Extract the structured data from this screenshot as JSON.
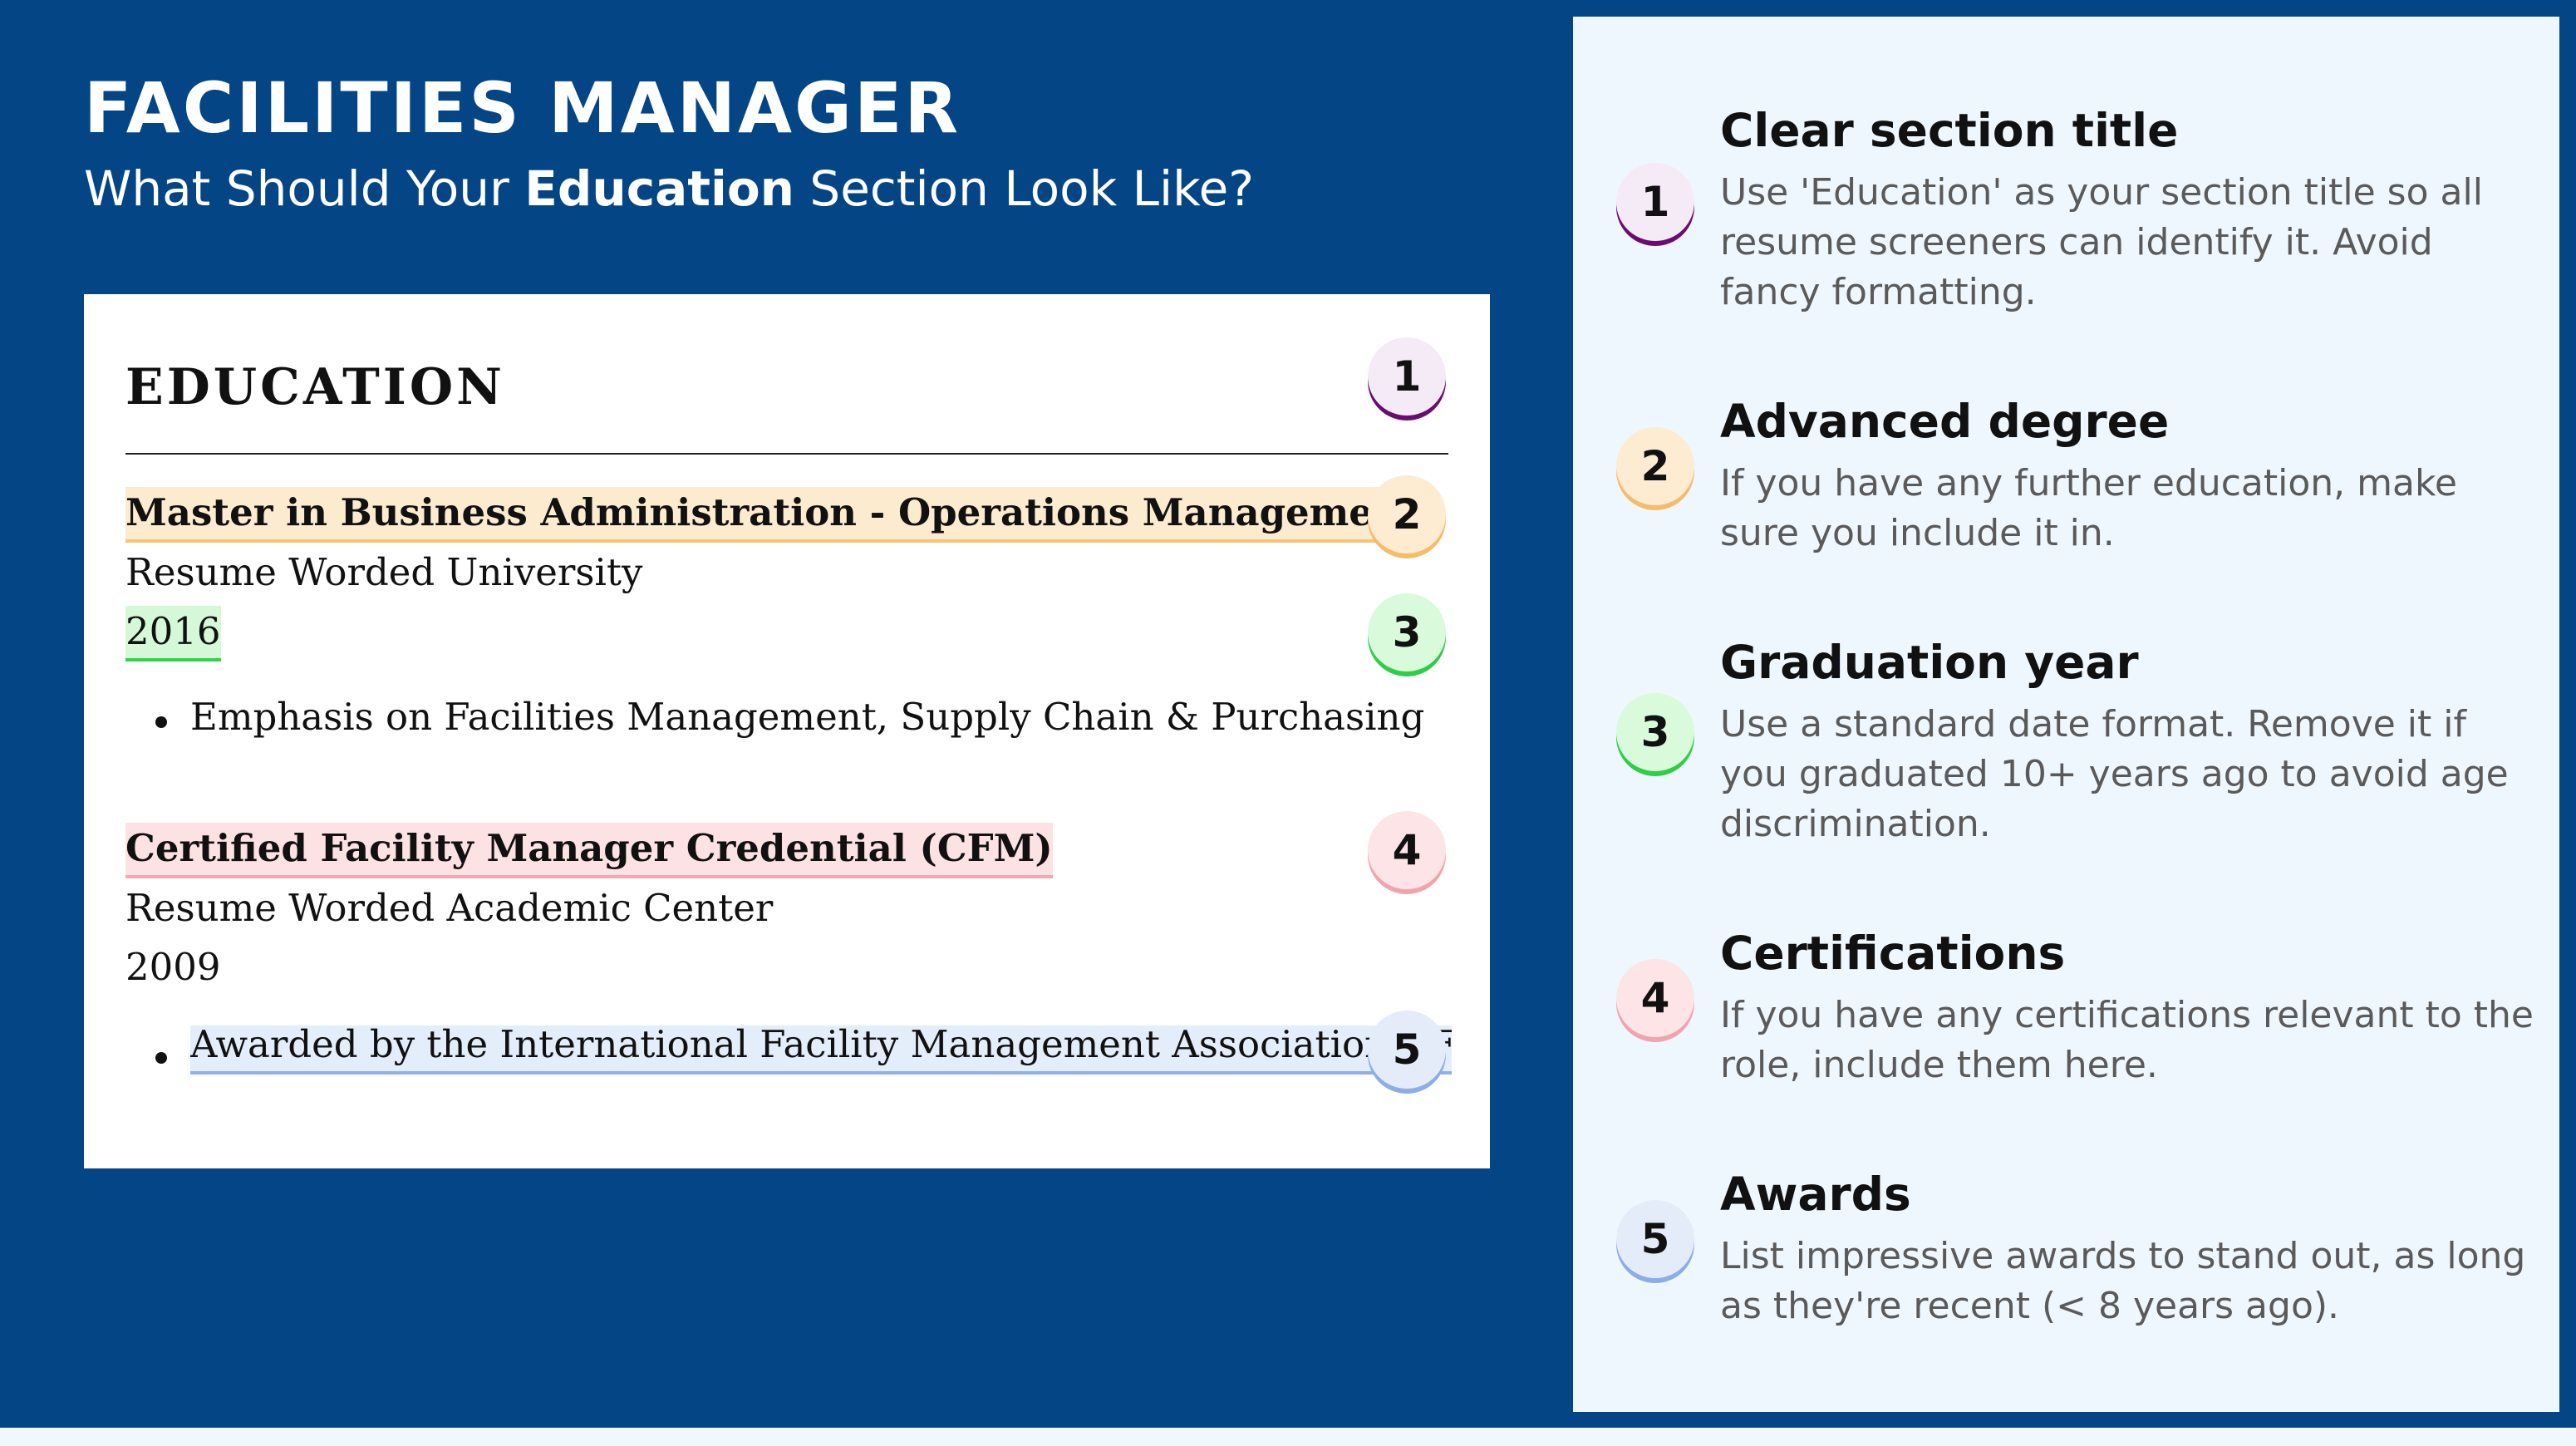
{
  "header": {
    "title": "FACILITIES MANAGER",
    "subtitle_pre": "What Should Your ",
    "subtitle_bold": "Education",
    "subtitle_post": " Section Look Like?"
  },
  "resume": {
    "heading": "EDUCATION",
    "entries": [
      {
        "degree": "Master in Business Administration - Operations Management",
        "school": "Resume Worded University",
        "year": "2016",
        "bullet": "Emphasis on Facilities Management, Supply Chain & Purchasing"
      },
      {
        "degree": "Certified Facility Manager Credential (CFM)",
        "school": "Resume Worded Academic Center",
        "year": "2009",
        "bullet": "Awarded by the International Facility Management Association (IFMA)"
      }
    ]
  },
  "tips": [
    {
      "number": "1",
      "title": "Clear section title",
      "body": "Use 'Education' as your section title so all resume screeners can identify it. Avoid fancy formatting."
    },
    {
      "number": "2",
      "title": "Advanced degree",
      "body": "If you have any further education, make sure you include it in."
    },
    {
      "number": "3",
      "title": "Graduation year",
      "body": "Use a standard date format. Remove it if you graduated 10+ years ago to avoid age discrimination."
    },
    {
      "number": "4",
      "title": "Certifications",
      "body": "If you have any certifications relevant to the role, include them here."
    },
    {
      "number": "5",
      "title": "Awards",
      "body": "List impressive awards to stand out, as long as they're recent (< 8 years ago)."
    }
  ],
  "colors": {
    "background": "#044586",
    "panel": "#eff7fe",
    "badge_1": "#6b0c70",
    "badge_2": "#f5bc6a",
    "badge_3": "#2fce47",
    "badge_4": "#f0a5ae",
    "badge_5": "#8aaee8"
  }
}
